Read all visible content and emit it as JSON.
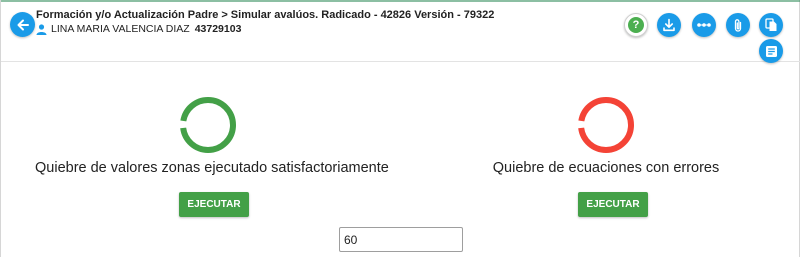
{
  "header": {
    "title_parts": [
      "Formación y/o Actualización Padre",
      "Simular avalúos. Radicado - 42826 Versión - 79322"
    ],
    "title_separator": ">",
    "user_name": "LINA MARIA VALENCIA DIAZ",
    "user_id": "43729103"
  },
  "toolbar": {
    "icons": [
      "help-icon",
      "download-icon",
      "more-icon",
      "attach-icon",
      "copy-icon",
      "document-list-icon"
    ],
    "help_glyph": "?"
  },
  "panels": [
    {
      "status": "success",
      "ring_color": "#43a047",
      "message": "Quiebre de valores zonas ejecutado satisfactoriamente",
      "button_label": "EJECUTAR"
    },
    {
      "status": "error",
      "ring_color": "#f44336",
      "message": "Quiebre de ecuaciones con errores",
      "button_label": "EJECUTAR"
    }
  ],
  "input": {
    "value": "60"
  },
  "colors": {
    "accent": "#1a9be8",
    "success": "#43a047",
    "error": "#f44336"
  }
}
